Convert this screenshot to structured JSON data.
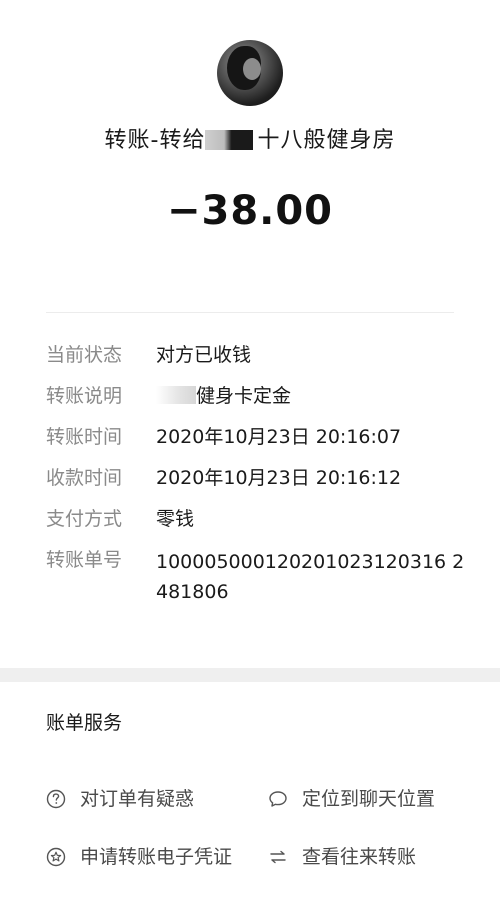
{
  "transfer": {
    "title_prefix": "转账-转给",
    "title_suffix": "十八般健身房",
    "amount": "−38.00"
  },
  "details": [
    {
      "label": "当前状态",
      "value": "对方已收钱"
    },
    {
      "label": "转账说明",
      "value": "健身卡定金"
    },
    {
      "label": "转账时间",
      "value": "2020年10月23日 20:16:07"
    },
    {
      "label": "收款时间",
      "value": "2020年10月23日 20:16:12"
    },
    {
      "label": "支付方式",
      "value": "零钱"
    },
    {
      "label": "转账单号",
      "value": "100005000120201023120316 2481806"
    }
  ],
  "services": {
    "title": "账单服务",
    "items": [
      {
        "label": "对订单有疑惑",
        "icon": "question-circle-icon"
      },
      {
        "label": "定位到聊天位置",
        "icon": "chat-bubble-icon"
      },
      {
        "label": "申请转账电子凭证",
        "icon": "star-badge-icon"
      },
      {
        "label": "查看往来转账",
        "icon": "swap-arrows-icon"
      }
    ]
  }
}
